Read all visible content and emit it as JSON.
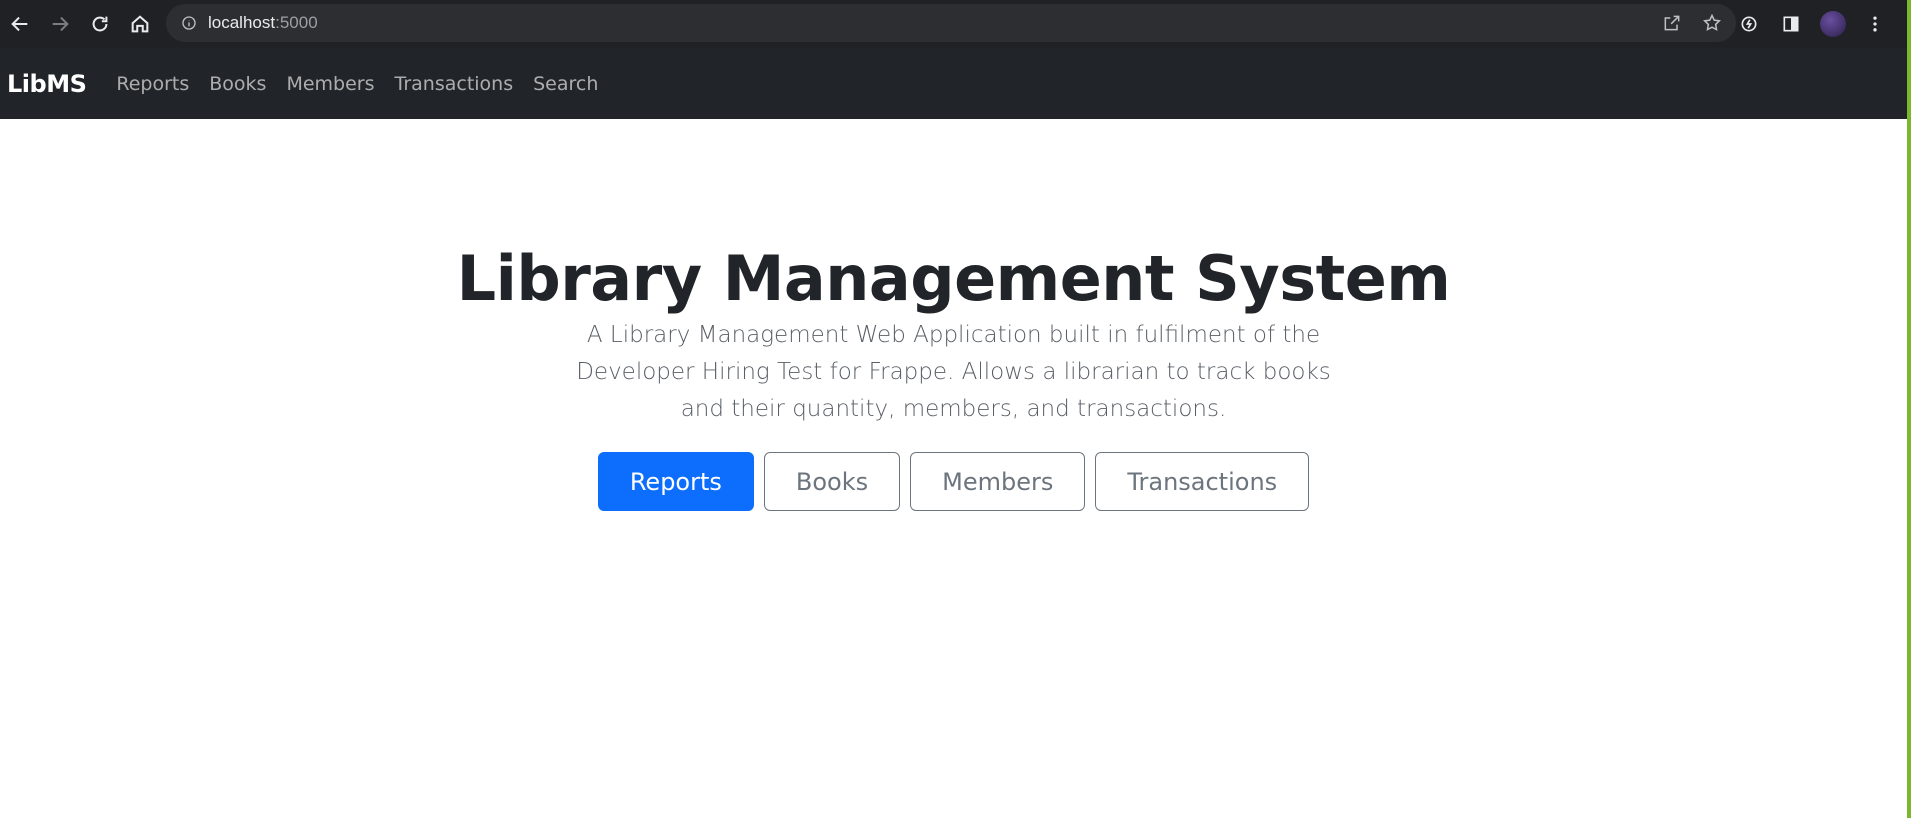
{
  "browser": {
    "url_host": "localhost",
    "url_port": ":5000"
  },
  "navbar": {
    "brand": "LibMS",
    "links": [
      "Reports",
      "Books",
      "Members",
      "Transactions",
      "Search"
    ]
  },
  "hero": {
    "title": "Library Management System",
    "description": "A Library Management Web Application built in fulfilment of the Developer Hiring Test for Frappe. Allows a librarian to track books and their quantity, members, and transactions.",
    "buttons": [
      "Reports",
      "Books",
      "Members",
      "Transactions"
    ]
  },
  "colors": {
    "navbar_bg": "#212529",
    "primary": "#0d6efd",
    "outline": "#6c757d"
  }
}
